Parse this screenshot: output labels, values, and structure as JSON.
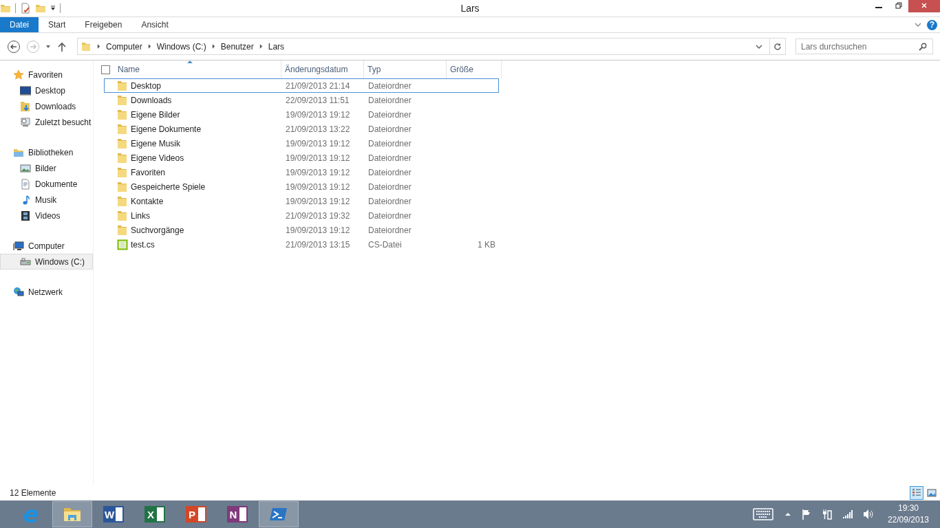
{
  "window": {
    "title": "Lars"
  },
  "ribbon": {
    "tabs": [
      {
        "label": "Datei",
        "selected": true
      },
      {
        "label": "Start",
        "selected": false
      },
      {
        "label": "Freigeben",
        "selected": false
      },
      {
        "label": "Ansicht",
        "selected": false
      }
    ],
    "help_label": "?"
  },
  "address": {
    "forward_disabled": true,
    "segments": [
      "Computer",
      "Windows (C:)",
      "Benutzer",
      "Lars"
    ],
    "search_placeholder": "Lars durchsuchen"
  },
  "sidebar": {
    "groups": [
      {
        "label": "Favoriten",
        "kind": "star",
        "selected": false,
        "children": [
          {
            "label": "Desktop",
            "kind": "desktop",
            "selected": false
          },
          {
            "label": "Downloads",
            "kind": "download",
            "selected": false
          },
          {
            "label": "Zuletzt besucht",
            "kind": "recent",
            "selected": false
          }
        ]
      },
      {
        "label": "Bibliotheken",
        "kind": "library",
        "selected": false,
        "children": [
          {
            "label": "Bilder",
            "kind": "pictures",
            "selected": false
          },
          {
            "label": "Dokumente",
            "kind": "documents",
            "selected": false
          },
          {
            "label": "Musik",
            "kind": "music",
            "selected": false
          },
          {
            "label": "Videos",
            "kind": "videos",
            "selected": false
          }
        ]
      },
      {
        "label": "Computer",
        "kind": "computer",
        "selected": false,
        "children": [
          {
            "label": "Windows (C:)",
            "kind": "drive",
            "selected": true
          }
        ]
      },
      {
        "label": "Netzwerk",
        "kind": "network",
        "selected": false
      }
    ]
  },
  "table": {
    "select_all_checked": false,
    "columns": [
      {
        "label": "Name",
        "sorted": true
      },
      {
        "label": "Änderungsdatum",
        "sorted": false
      },
      {
        "label": "Typ",
        "sorted": false
      },
      {
        "label": "Größe",
        "sorted": false
      }
    ],
    "rows": [
      {
        "name": "Desktop",
        "date": "21/09/2013 21:14",
        "type": "Dateiordner",
        "kind": "folder",
        "focused": true
      },
      {
        "name": "Downloads",
        "date": "22/09/2013 11:51",
        "type": "Dateiordner",
        "kind": "folder",
        "focused": false
      },
      {
        "name": "Eigene Bilder",
        "date": "19/09/2013 19:12",
        "type": "Dateiordner",
        "kind": "folder",
        "focused": false
      },
      {
        "name": "Eigene Dokumente",
        "date": "21/09/2013 13:22",
        "type": "Dateiordner",
        "kind": "folder",
        "focused": false
      },
      {
        "name": "Eigene Musik",
        "date": "19/09/2013 19:12",
        "type": "Dateiordner",
        "kind": "folder",
        "focused": false
      },
      {
        "name": "Eigene Videos",
        "date": "19/09/2013 19:12",
        "type": "Dateiordner",
        "kind": "folder",
        "focused": false
      },
      {
        "name": "Favoriten",
        "date": "19/09/2013 19:12",
        "type": "Dateiordner",
        "kind": "folder",
        "focused": false
      },
      {
        "name": "Gespeicherte Spiele",
        "date": "19/09/2013 19:12",
        "type": "Dateiordner",
        "kind": "folder",
        "focused": false
      },
      {
        "name": "Kontakte",
        "date": "19/09/2013 19:12",
        "type": "Dateiordner",
        "kind": "folder",
        "focused": false
      },
      {
        "name": "Links",
        "date": "21/09/2013 19:32",
        "type": "Dateiordner",
        "kind": "folder",
        "focused": false
      },
      {
        "name": "Suchvorgänge",
        "date": "19/09/2013 19:12",
        "type": "Dateiordner",
        "kind": "folder",
        "focused": false
      },
      {
        "name": "test.cs",
        "date": "21/09/2013 13:15",
        "type": "CS-Datei",
        "size": "1 KB",
        "kind": "file",
        "focused": false
      }
    ]
  },
  "status_bar": {
    "count": "12 Elemente",
    "views": [
      {
        "kind": "details",
        "selected": true
      },
      {
        "kind": "large",
        "selected": false
      }
    ]
  },
  "taskbar": {
    "apps": [
      {
        "kind": "browser",
        "label": "e",
        "color": "#1e90e0",
        "active": false
      },
      {
        "kind": "folder",
        "active": true
      },
      {
        "kind": "letter",
        "label": "W",
        "color": "#2b579a",
        "active": false
      },
      {
        "kind": "letter",
        "label": "X",
        "color": "#217346",
        "active": false
      },
      {
        "kind": "letter",
        "label": "P",
        "color": "#d24726",
        "active": false
      },
      {
        "kind": "letter",
        "label": "N",
        "color": "#80397b",
        "active": false
      },
      {
        "kind": "shell",
        "active": true
      }
    ],
    "time": "19:30",
    "date": "22/09/2013"
  }
}
